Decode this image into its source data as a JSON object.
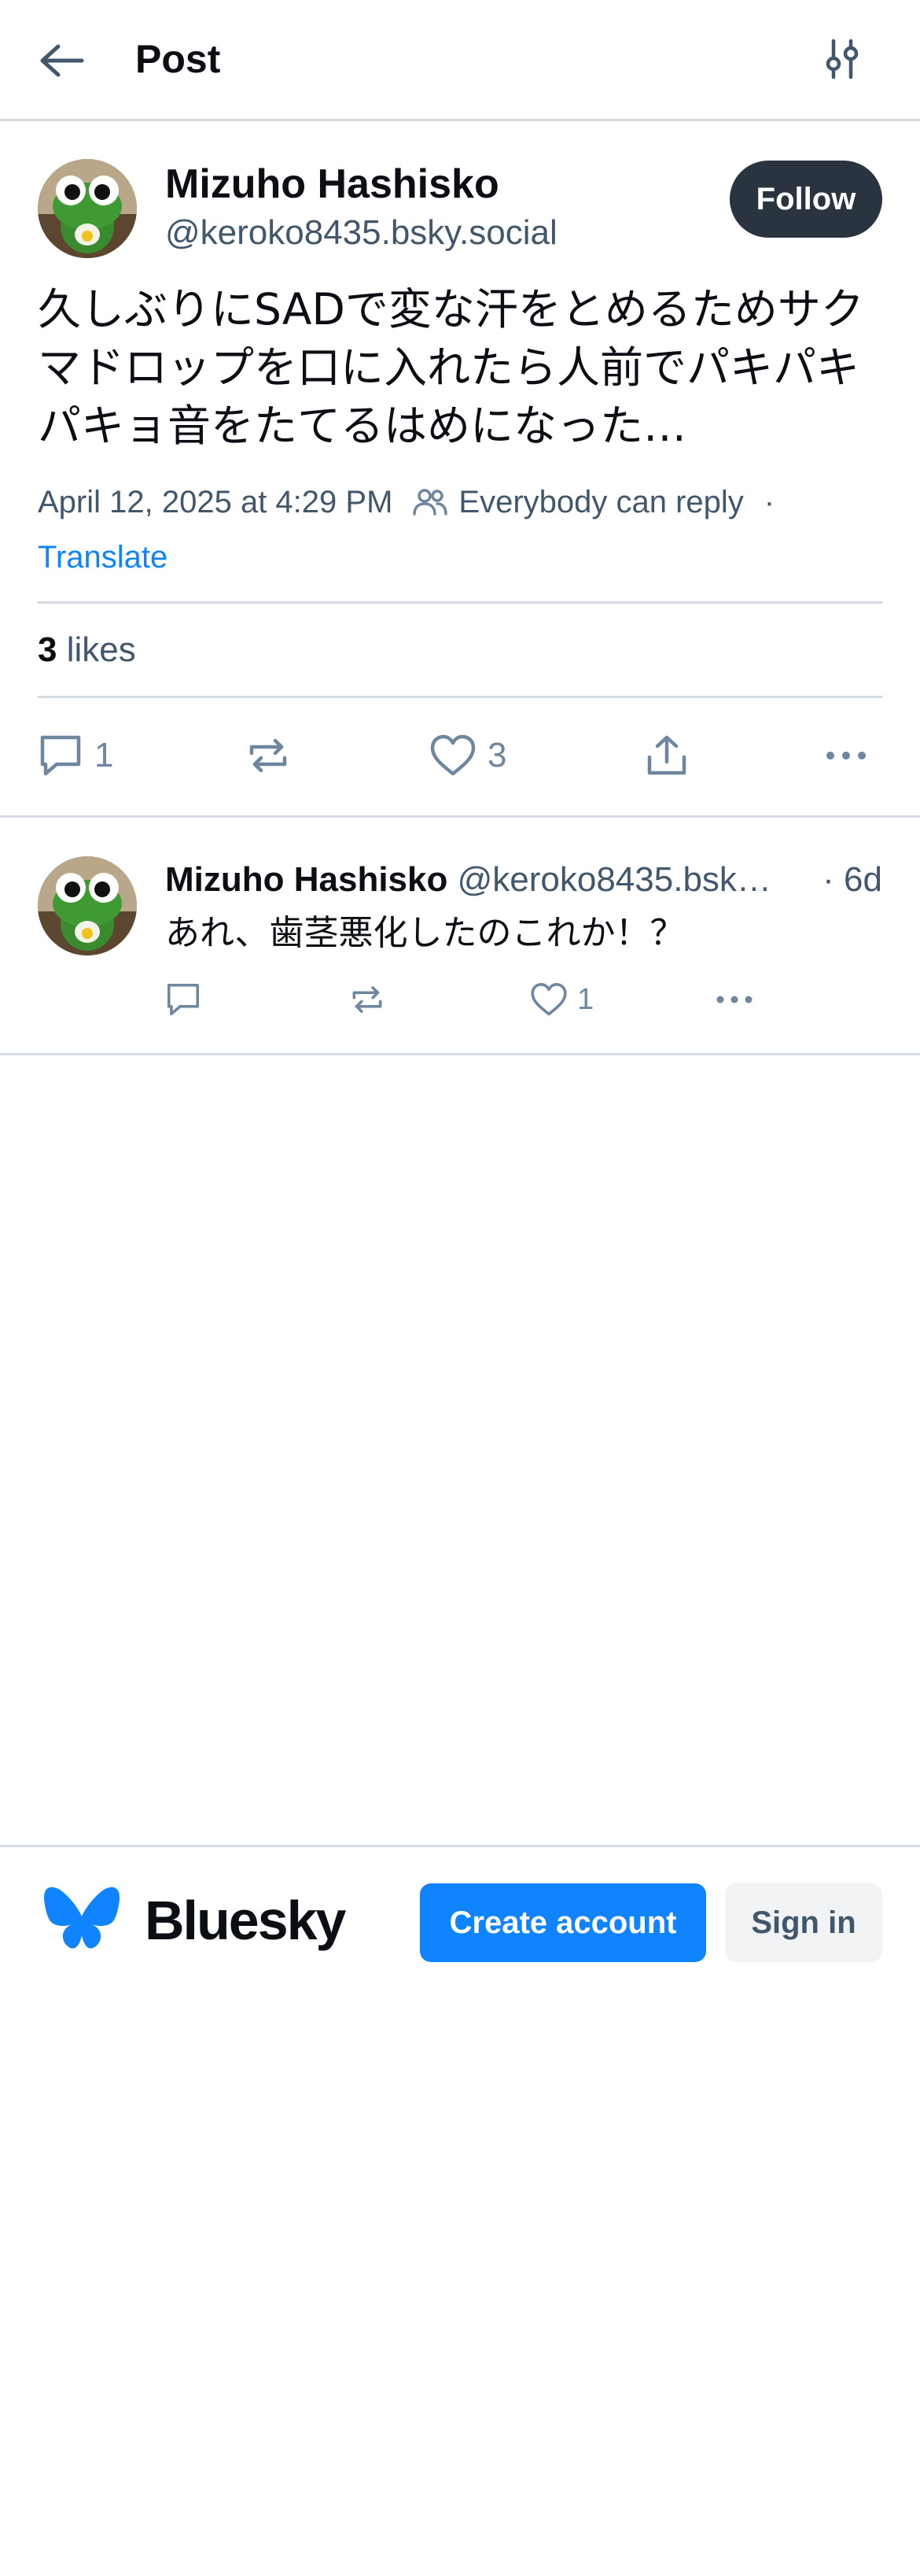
{
  "header": {
    "title": "Post",
    "back_icon": "arrow-left-icon",
    "filter_icon": "sliders-icon"
  },
  "post": {
    "author_name": "Mizuho Hashisko",
    "author_handle": "@keroko8435.bsky.social",
    "follow_label": "Follow",
    "text": "久しぶりにSADで変な汗をとめるためサクマドロップを口に入れたら人前でパキパキパキョ音をたてるはめになった…",
    "timestamp": "April 12, 2025 at 4:29 PM",
    "reply_setting": "Everybody can reply",
    "separator": "·",
    "translate_label": "Translate",
    "likes_count": "3",
    "likes_label": "likes",
    "actions": {
      "reply_count": "1",
      "repost_count": "",
      "like_count": "3"
    }
  },
  "reply": {
    "author_name": "Mizuho Hashisko",
    "author_handle": "@keroko8435.bsk…",
    "time": "· 6d",
    "text": "あれ、歯茎悪化したのこれか！？",
    "actions": {
      "reply_count": "",
      "repost_count": "",
      "like_count": "1"
    }
  },
  "bottom_bar": {
    "brand": "Bluesky",
    "create_account_label": "Create account",
    "sign_in_label": "Sign in"
  },
  "colors": {
    "accent": "#1083fe",
    "follow_bg": "#2a3440",
    "muted_text": "#42576c",
    "icon": "#6f869f",
    "divider": "#d4dbe2"
  }
}
